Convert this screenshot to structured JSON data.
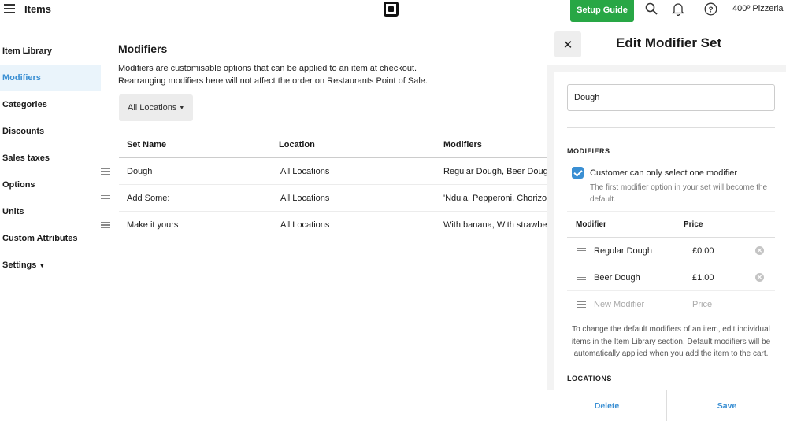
{
  "header": {
    "title": "Items",
    "setup_guide": "Setup Guide",
    "merchant": "400º Pizzeria"
  },
  "sidebar": {
    "items": [
      {
        "label": "Item Library"
      },
      {
        "label": "Modifiers"
      },
      {
        "label": "Categories"
      },
      {
        "label": "Discounts"
      },
      {
        "label": "Sales taxes"
      },
      {
        "label": "Options"
      },
      {
        "label": "Units"
      },
      {
        "label": "Custom Attributes"
      },
      {
        "label": "Settings"
      }
    ]
  },
  "main": {
    "title": "Modifiers",
    "description_line1": "Modifiers are customisable options that can be applied to an item at checkout.",
    "description_line2": "Rearranging modifiers here will not affect the order on Restaurants Point of Sale.",
    "location_filter": "All Locations",
    "columns": [
      "Set Name",
      "Location",
      "Modifiers"
    ],
    "rows": [
      {
        "name": "Dough",
        "location": "All Locations",
        "modifiers": "Regular Dough, Beer Dough"
      },
      {
        "name": "Add Some:",
        "location": "All Locations",
        "modifiers": "'Nduia, Pepperoni, Chorizo"
      },
      {
        "name": "Make it yours",
        "location": "All Locations",
        "modifiers": "With banana, With strawberry"
      }
    ]
  },
  "panel": {
    "title": "Edit Modifier Set",
    "name_value": "Dough",
    "modifiers_label": "MODIFIERS",
    "single_select_label": "Customer can only select one modifier",
    "single_select_checked": true,
    "single_select_help": "The first modifier option in your set will become the default.",
    "col_modifier": "Modifier",
    "col_price": "Price",
    "modifiers": [
      {
        "name": "Regular Dough",
        "price": "£0.00"
      },
      {
        "name": "Beer Dough",
        "price": "£1.00"
      }
    ],
    "new_modifier_placeholder": "New Modifier",
    "price_placeholder": "Price",
    "default_note": "To change the default modifiers of an item, edit individual items in the Item Library section. Default modifiers will be automatically applied when you add the item to the cart.",
    "locations_label": "LOCATIONS",
    "delete_label": "Delete",
    "save_label": "Save"
  },
  "colors": {
    "accent": "#3a8fd3",
    "setup_button": "#28a745",
    "active_nav_bg": "#eaf4fb"
  }
}
